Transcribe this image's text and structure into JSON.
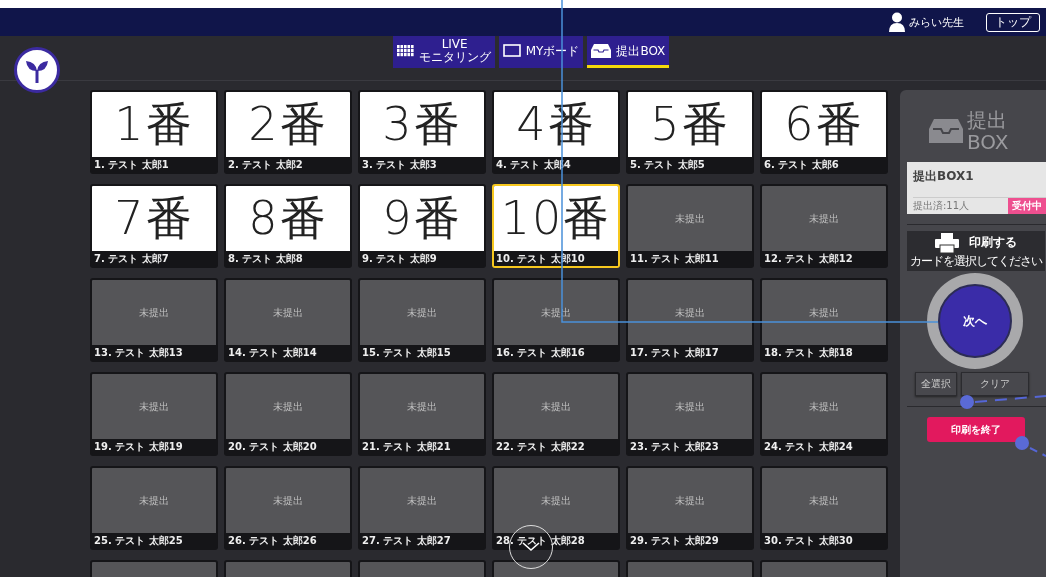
{
  "header": {
    "user_name": "みらい先生",
    "top_button": "トップ"
  },
  "tabs": [
    {
      "label_top": "LIVE",
      "label": "モニタリング",
      "selected": false
    },
    {
      "label": "MYボード",
      "selected": false
    },
    {
      "label": "提出BOX",
      "selected": true
    }
  ],
  "cards": [
    {
      "kind": "answer",
      "answer": "1番",
      "label": "1. テスト 太郎1",
      "selected": false
    },
    {
      "kind": "answer",
      "answer": "2番",
      "label": "2. テスト 太郎2",
      "selected": false
    },
    {
      "kind": "answer",
      "answer": "3番",
      "label": "3. テスト 太郎3",
      "selected": false
    },
    {
      "kind": "answer",
      "answer": "4番",
      "label": "4. テスト 太郎4",
      "selected": false
    },
    {
      "kind": "answer",
      "answer": "5番",
      "label": "5. テスト 太郎5",
      "selected": false
    },
    {
      "kind": "answer",
      "answer": "6番",
      "label": "6. テスト 太郎6",
      "selected": false
    },
    {
      "kind": "answer",
      "answer": "7番",
      "label": "7. テスト 太郎7",
      "selected": false
    },
    {
      "kind": "answer",
      "answer": "8番",
      "label": "8. テスト 太郎8",
      "selected": false
    },
    {
      "kind": "answer",
      "answer": "9番",
      "label": "9. テスト 太郎9",
      "selected": false
    },
    {
      "kind": "answer",
      "answer": "10番",
      "label": "10. テスト 太郎10",
      "selected": true
    },
    {
      "kind": "empty",
      "status": "未提出",
      "label": "11. テスト 太郎11",
      "selected": false
    },
    {
      "kind": "empty",
      "status": "未提出",
      "label": "12. テスト 太郎12",
      "selected": false
    },
    {
      "kind": "empty",
      "status": "未提出",
      "label": "13. テスト 太郎13",
      "selected": false
    },
    {
      "kind": "empty",
      "status": "未提出",
      "label": "14. テスト 太郎14",
      "selected": false
    },
    {
      "kind": "empty",
      "status": "未提出",
      "label": "15. テスト 太郎15",
      "selected": false
    },
    {
      "kind": "empty",
      "status": "未提出",
      "label": "16. テスト 太郎16",
      "selected": false
    },
    {
      "kind": "empty",
      "status": "未提出",
      "label": "17. テスト 太郎17",
      "selected": false
    },
    {
      "kind": "empty",
      "status": "未提出",
      "label": "18. テスト 太郎18",
      "selected": false
    },
    {
      "kind": "empty",
      "status": "未提出",
      "label": "19. テスト 太郎19",
      "selected": false
    },
    {
      "kind": "empty",
      "status": "未提出",
      "label": "20. テスト 太郎20",
      "selected": false
    },
    {
      "kind": "empty",
      "status": "未提出",
      "label": "21. テスト 太郎21",
      "selected": false
    },
    {
      "kind": "empty",
      "status": "未提出",
      "label": "22. テスト 太郎22",
      "selected": false
    },
    {
      "kind": "empty",
      "status": "未提出",
      "label": "23. テスト 太郎23",
      "selected": false
    },
    {
      "kind": "empty",
      "status": "未提出",
      "label": "24. テスト 太郎24",
      "selected": false
    },
    {
      "kind": "empty",
      "status": "未提出",
      "label": "25. テスト 太郎25",
      "selected": false
    },
    {
      "kind": "empty",
      "status": "未提出",
      "label": "26. テスト 太郎26",
      "selected": false
    },
    {
      "kind": "empty",
      "status": "未提出",
      "label": "27. テスト 太郎27",
      "selected": false
    },
    {
      "kind": "empty",
      "status": "未提出",
      "label": "28. テスト 太郎28",
      "selected": false
    },
    {
      "kind": "empty",
      "status": "未提出",
      "label": "29. テスト 太郎29",
      "selected": false
    },
    {
      "kind": "empty",
      "status": "未提出",
      "label": "30. テスト 太郎30",
      "selected": false
    },
    {
      "kind": "empty",
      "selected": false
    },
    {
      "kind": "empty",
      "selected": false
    },
    {
      "kind": "empty",
      "selected": false
    },
    {
      "kind": "empty",
      "selected": false
    },
    {
      "kind": "empty",
      "selected": false
    },
    {
      "kind": "empty",
      "selected": false
    }
  ],
  "panel": {
    "title_lines": [
      "提出",
      "BOX"
    ],
    "box_name": "提出BOX1",
    "submitted": "提出済:11人",
    "badge": "受付中",
    "print_button": "印刷する",
    "print_hint": "カードを選択してください",
    "next_button": "次へ",
    "select_all_button": "全選択",
    "clear_button": "クリア",
    "end_print_button": "印刷を終了"
  }
}
